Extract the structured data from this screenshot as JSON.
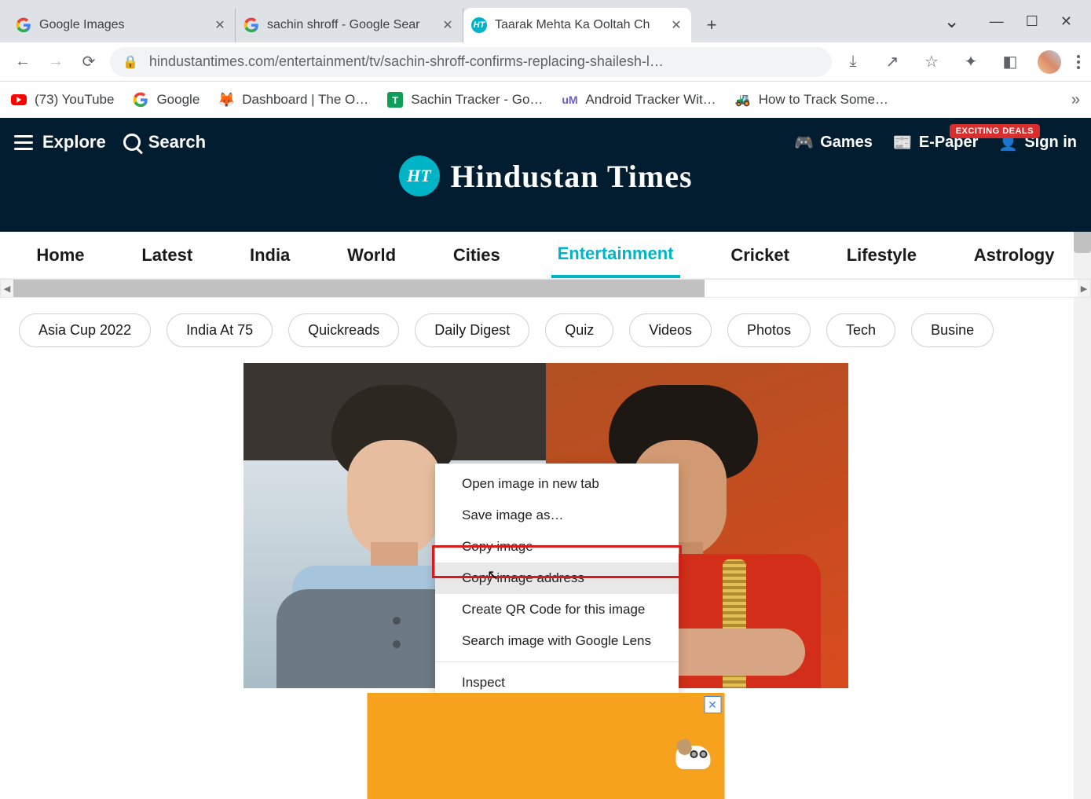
{
  "browser": {
    "tabs": [
      {
        "title": "Google Images",
        "active": false
      },
      {
        "title": "sachin shroff - Google Sear",
        "active": false
      },
      {
        "title": "Taarak Mehta Ka Ooltah Ch",
        "active": true
      }
    ],
    "url": "hindustantimes.com/entertainment/tv/sachin-shroff-confirms-replacing-shailesh-l…"
  },
  "bookmarks": [
    {
      "label": "(73) YouTube"
    },
    {
      "label": "Google"
    },
    {
      "label": "Dashboard | The O…"
    },
    {
      "label": "Sachin Tracker - Go…"
    },
    {
      "label": "Android Tracker Wit…"
    },
    {
      "label": "How to Track Some…"
    }
  ],
  "site": {
    "badge": "EXCITING DEALS",
    "explore": "Explore",
    "search": "Search",
    "brand_short": "HT",
    "brand": "Hindustan Times",
    "header_links": {
      "games": "Games",
      "epaper": "E-Paper",
      "signin": "Sign in"
    }
  },
  "mainnav": [
    {
      "label": "Home",
      "active": false
    },
    {
      "label": "Latest",
      "active": false
    },
    {
      "label": "India",
      "active": false
    },
    {
      "label": "World",
      "active": false
    },
    {
      "label": "Cities",
      "active": false
    },
    {
      "label": "Entertainment",
      "active": true
    },
    {
      "label": "Cricket",
      "active": false
    },
    {
      "label": "Lifestyle",
      "active": false
    },
    {
      "label": "Astrology",
      "active": false
    }
  ],
  "tags": [
    "Asia Cup 2022",
    "India At 75",
    "Quickreads",
    "Daily Digest",
    "Quiz",
    "Videos",
    "Photos",
    "Tech",
    "Busine"
  ],
  "context_menu": {
    "items": [
      "Open image in new tab",
      "Save image as…",
      "Copy image",
      "Copy image address",
      "Create QR Code for this image",
      "Search image with Google Lens"
    ],
    "inspect": "Inspect",
    "hover_index": 3
  }
}
